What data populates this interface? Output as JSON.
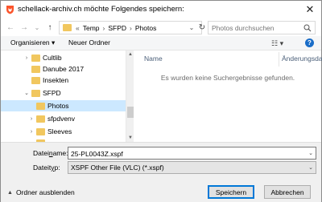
{
  "window": {
    "title": "schellack-archiv.ch möchte Folgendes speichern:",
    "close_glyph": "✕",
    "app_icon": "brave-lion-icon"
  },
  "nav": {
    "back_glyph": "←",
    "forward_glyph": "→",
    "recent_glyph": "⌄",
    "up_glyph": "↑",
    "breadcrumb": [
      "«",
      "Temp",
      "›",
      "SFPD",
      "›",
      "Photos"
    ],
    "dropdown_glyph": "⌄",
    "refresh_glyph": "↻",
    "search_placeholder": "Photos durchsuchen"
  },
  "toolbar": {
    "organize_label": "Organisieren ▾",
    "new_folder_label": "Neuer Ordner",
    "view_glyph": "☷ ▾",
    "help_glyph": "?"
  },
  "tree": {
    "items": [
      {
        "label": "Cultlib",
        "has_chevron": true,
        "selected": false,
        "indent": 2
      },
      {
        "label": "Danube 2017",
        "has_chevron": false,
        "selected": false,
        "indent": 2
      },
      {
        "label": "Insekten",
        "has_chevron": false,
        "selected": false,
        "indent": 2
      },
      {
        "label": "SFPD",
        "has_chevron": true,
        "expanded": true,
        "selected": false,
        "indent": 2
      },
      {
        "label": "Photos",
        "has_chevron": false,
        "selected": true,
        "indent": 3
      },
      {
        "label": "sfpdvenv",
        "has_chevron": true,
        "selected": false,
        "indent": 3
      },
      {
        "label": "Sleeves",
        "has_chevron": true,
        "selected": false,
        "indent": 3
      },
      {
        "label": "",
        "has_chevron": true,
        "selected": false,
        "indent": 3
      }
    ],
    "chev_collapsed": "›",
    "chev_expanded": "⌄"
  },
  "filelist": {
    "columns": [
      "Name",
      "Änderungsdatu"
    ],
    "empty_message": "Es wurden keine Suchergebnisse gefunden."
  },
  "form": {
    "filename_label_pre": "Datei",
    "filename_label_u": "n",
    "filename_label_post": "ame:",
    "filename_value": "25-PL0043Z.xspf",
    "filetype_label_pre": "Dateit",
    "filetype_label_u": "y",
    "filetype_label_post": "p:",
    "filetype_value": "XSPF Other File (VLC) (*.xspf)",
    "drop_glyph": "⌄"
  },
  "footer": {
    "hide_folders_label": "Ordner ausblenden",
    "hide_folders_caret": "▲",
    "save_label": "Speichern",
    "cancel_label": "Abbrechen"
  },
  "colors": {
    "selection": "#cce8ff",
    "folder": "#f1c75f",
    "accent": "#0078d7"
  }
}
